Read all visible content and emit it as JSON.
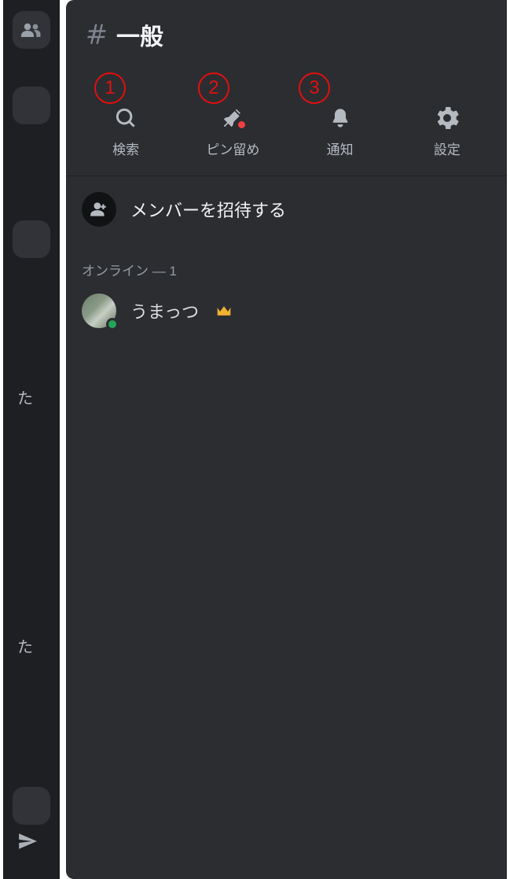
{
  "channel": {
    "name": "一般"
  },
  "actions": {
    "search": {
      "label": "検索"
    },
    "pin": {
      "label": "ピン留め",
      "has_badge": true
    },
    "notifications": {
      "label": "通知"
    },
    "settings": {
      "label": "設定"
    }
  },
  "annotations": {
    "one": "1",
    "two": "2",
    "three": "3"
  },
  "invite": {
    "label": "メンバーを招待する"
  },
  "online_section": {
    "label": "オンライン",
    "count": "1"
  },
  "members": [
    {
      "name": "うまっつ",
      "is_owner": true,
      "status": "online"
    }
  ],
  "sidebar_partial_text_1": "た",
  "sidebar_partial_text_2": "た",
  "colors": {
    "annotation": "#e20f0f",
    "panel_bg": "#2b2d31",
    "sidebar_bg": "#1e1f22"
  }
}
